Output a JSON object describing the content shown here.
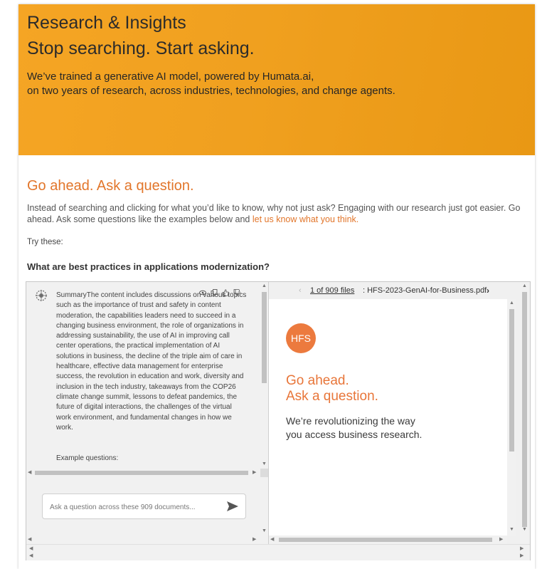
{
  "hero": {
    "title_line1": "Research & Insights",
    "title_line2": "Stop searching. Start asking.",
    "sub_line1": "We’ve trained a generative AI model, powered by Humata.ai,",
    "sub_line2": "on two years of research, across industries, technologies, and change agents.",
    "background_color": "#f0a01f"
  },
  "ask": {
    "heading": "Go ahead. Ask a question.",
    "intro_text": "Instead of searching and clicking for what you’d like to know, why not just ask? Engaging with our research just got easier. Go ahead. Ask some questions like the examples below and",
    "intro_link": "let us know what you think.",
    "try_label": "Try these:",
    "example_question": "What are best practices in applications modernization?",
    "accent_color": "#e2762b"
  },
  "chat": {
    "summary_text": "SummaryThe content includes discussions on various topics such as the importance of trust and safety in content moderation, the capabilities leaders need to succeed in a changing business environment, the role of organizations in addressing sustainability, the use of AI in improving call center operations, the practical implementation of AI solutions in business, the decline of the triple aim of care in healthcare, effective data management for enterprise success, the revolution in education and work, diversity and inclusion in the tech industry, takeaways from the COP26 climate change summit, lessons to defeat pandemics, the future of digital interactions, the challenges of the virtual work environment, and fundamental changes in how we work.",
    "example_questions_label": "Example questions:",
    "input_placeholder": "Ask a question across these 909 documents...",
    "icons": [
      "eye-icon",
      "copy-icon",
      "thumbs-up-icon",
      "thumbs-down-icon"
    ]
  },
  "document": {
    "file_count": "1 of 909 files",
    "file_name": ": HFS-2023-GenAI-for-Business.pdf",
    "logo_text": "HFS",
    "heading_line1": "Go ahead.",
    "heading_line2": "Ask a question.",
    "body_line1": "We’re revolutionizing the way",
    "body_line2": "you access business research.",
    "logo_color": "#ec7a3e"
  }
}
